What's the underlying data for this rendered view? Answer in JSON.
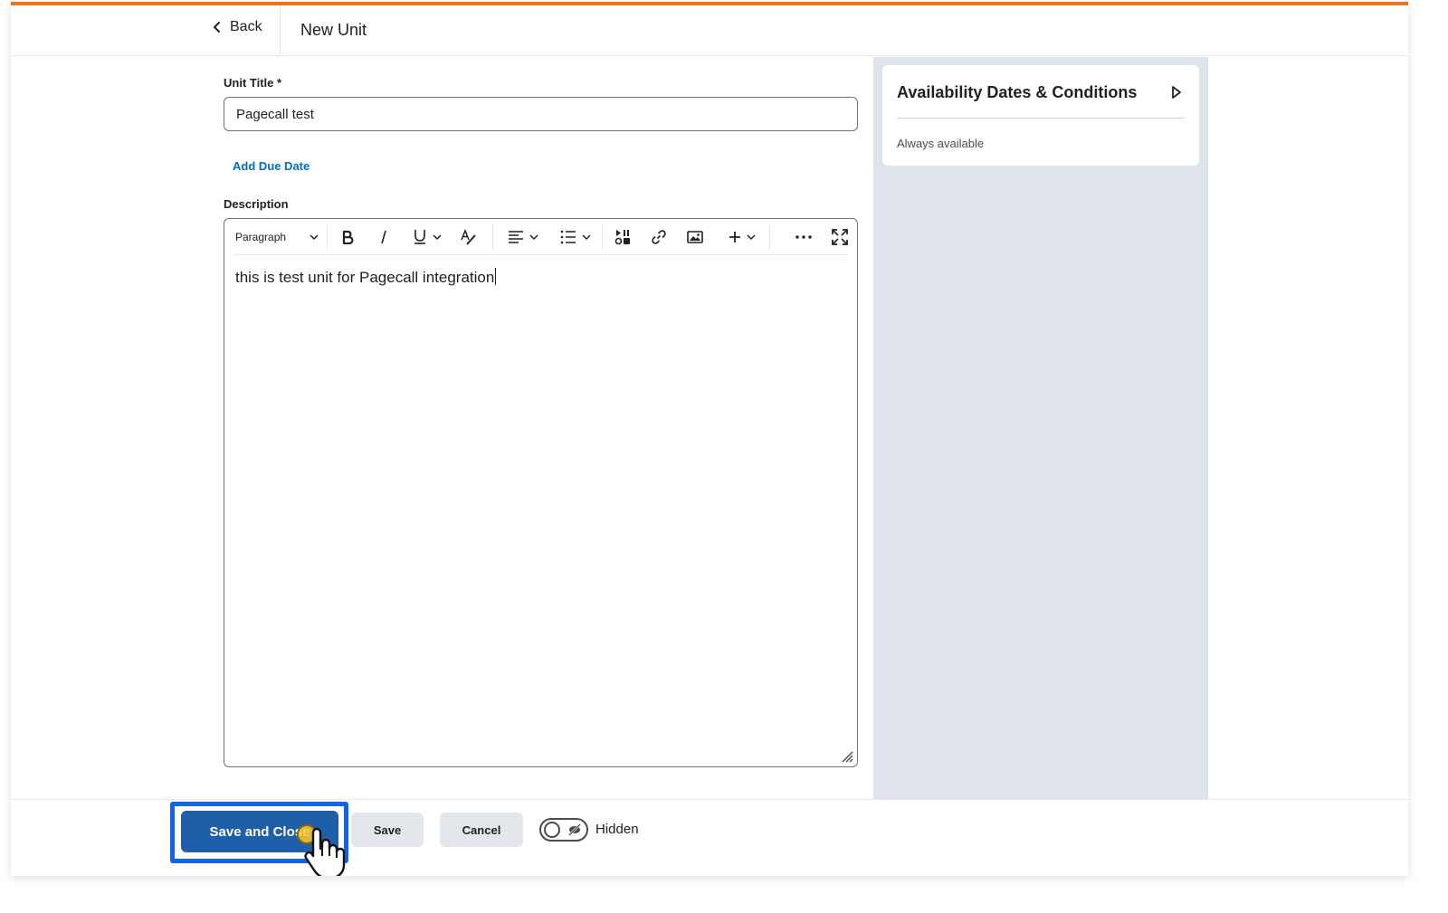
{
  "header": {
    "back_label": "Back",
    "page_title": "New Unit"
  },
  "form": {
    "unit_title_label": "Unit Title *",
    "unit_title_value": "Pagecall test",
    "add_due_date_label": "Add Due Date",
    "description_label": "Description"
  },
  "editor": {
    "paragraph_style": "Paragraph",
    "content": "this is test unit for Pagecall integration",
    "toolbar_icons": [
      "bold-icon",
      "italic-icon",
      "underline-icon",
      "text-style-icon",
      "align-icon",
      "list-icon",
      "insert-stuff-icon",
      "link-icon",
      "image-icon",
      "add-icon",
      "more-icon",
      "fullscreen-icon"
    ]
  },
  "availability": {
    "title": "Availability Dates & Conditions",
    "status": "Always available"
  },
  "footer": {
    "save_and_close_label": "Save and Close",
    "save_label": "Save",
    "cancel_label": "Cancel",
    "visibility_label": "Hidden"
  },
  "colors": {
    "accent_top_bar": "#e87722",
    "primary_button": "#1f5ea8",
    "link": "#006fbf",
    "side_panel_bg": "#dfe4ec",
    "highlight_border": "#1363e6"
  }
}
